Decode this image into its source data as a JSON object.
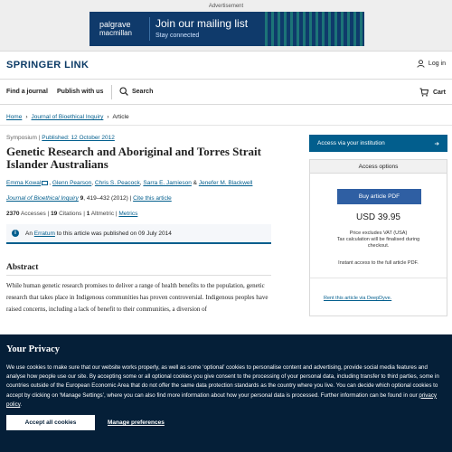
{
  "ad": {
    "label": "Advertisement",
    "brand_top": "palgrave",
    "brand_bottom": "macmillan",
    "headline": "Join our mailing list",
    "subline": "Stay connected"
  },
  "header": {
    "brand": "SPRINGER LINK",
    "login": "Log in"
  },
  "nav": {
    "find_journal": "Find a journal",
    "publish": "Publish with us",
    "search": "Search",
    "cart": "Cart"
  },
  "breadcrumb": [
    "Home",
    "Journal of Bioethical Inquiry",
    "Article"
  ],
  "article": {
    "type": "Symposium",
    "published": "Published: 12 October 2012",
    "title": "Genetic Research and Aboriginal and Torres Strait Islander Australians",
    "authors": [
      "Emma Kowal",
      "Glenn Pearson",
      "Chris S. Peacock",
      "Sarra E. Jamieson",
      "Jenefer M. Blackwell"
    ],
    "journal": "Journal of Bioethical Inquiry",
    "volume": "9",
    "pages": ", 419–432 (2012)",
    "cite": "Cite this article",
    "metrics": {
      "accesses_num": "2370",
      "accesses_label": "Accesses",
      "citations_num": "19",
      "citations_label": "Citations",
      "altmetric_num": "1",
      "altmetric_label": "Altmetric",
      "metrics_link": "Metrics"
    },
    "erratum": {
      "prefix": "An",
      "link": "Erratum",
      "suffix": "to this article was published on 09 July 2014"
    },
    "abstract_heading": "Abstract",
    "abstract_text": "While human genetic research promises to deliver a range of health benefits to the population, genetic research that takes place in Indigenous communities has proven controversial. Indigenous peoples have raised concerns, including a lack of benefit to their communities, a diversion of"
  },
  "sidebar": {
    "institution_btn": "Access via your institution",
    "options_heading": "Access options",
    "buy_btn": "Buy article PDF",
    "price": "USD 39.95",
    "price_note_1": "Price excludes VAT (USA)",
    "price_note_2": "Tax calculation will be finalised during checkout.",
    "instant": "Instant access to the full article PDF.",
    "rent": "Rent this article via DeepDyve."
  },
  "cookie": {
    "heading": "Your Privacy",
    "body_1": "We use cookies to make sure that our website works properly, as well as some ‘optional’ cookies to personalise content and advertising, provide social media features and analyse how people use our site. By accepting some or all optional cookies you give consent to the processing of your personal data, including transfer to third parties, some in countries outside of the European Economic Area that do not offer the same data protection standards as the country where you live. You can decide which optional cookies to accept by clicking on ‘Manage Settings’, where you can also find more information about how your personal data is processed. Further information can be found in our ",
    "privacy_link": "privacy policy",
    "body_end": ".",
    "accept": "Accept all cookies",
    "manage": "Manage preferences"
  },
  "colors": {
    "link": "#025e8d",
    "cookie_bg": "#051f38",
    "buy_button": "#2f5fa3"
  }
}
